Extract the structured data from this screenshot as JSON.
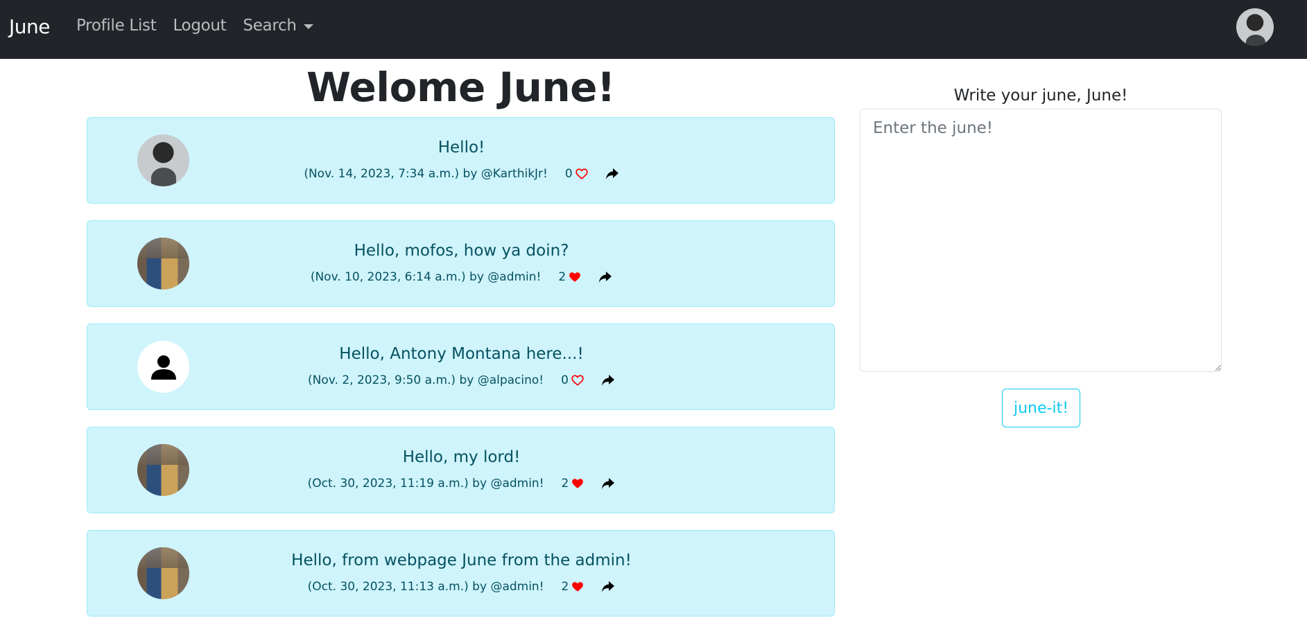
{
  "navbar": {
    "brand": "June",
    "links": [
      "Profile List",
      "Logout",
      "Search"
    ]
  },
  "main": {
    "welcome": "Welome June!"
  },
  "feed": [
    {
      "text": "Hello!",
      "meta": "(Nov. 14, 2023, 7:34 a.m.) by @KarthikJr!",
      "likes": "0",
      "liked": false,
      "avatar": "avatar-photo"
    },
    {
      "text": "Hello, mofos, how ya doin?",
      "meta": "(Nov. 10, 2023, 6:14 a.m.) by @admin!",
      "likes": "2",
      "liked": true,
      "avatar": "avatar-photo"
    },
    {
      "text": "Hello, Antony Montana here...!",
      "meta": "(Nov. 2, 2023, 9:50 a.m.) by @alpacino!",
      "likes": "0",
      "liked": false,
      "avatar": "default-user-icon"
    },
    {
      "text": "Hello, my lord!",
      "meta": "(Oct. 30, 2023, 11:19 a.m.) by @admin!",
      "likes": "2",
      "liked": true,
      "avatar": "avatar-photo"
    },
    {
      "text": "Hello, from webpage June from the admin!",
      "meta": "(Oct. 30, 2023, 11:13 a.m.) by @admin!",
      "likes": "2",
      "liked": true,
      "avatar": "avatar-photo"
    }
  ],
  "compose": {
    "label": "Write your june, June!",
    "placeholder": "Enter the june!",
    "value": "",
    "submit_label": "june-it!"
  },
  "colors": {
    "navbar_bg": "#212529",
    "card_bg": "#cff4fc",
    "card_text": "#055160",
    "heart": "#ff0000",
    "button_accent": "#0dcaf0"
  }
}
